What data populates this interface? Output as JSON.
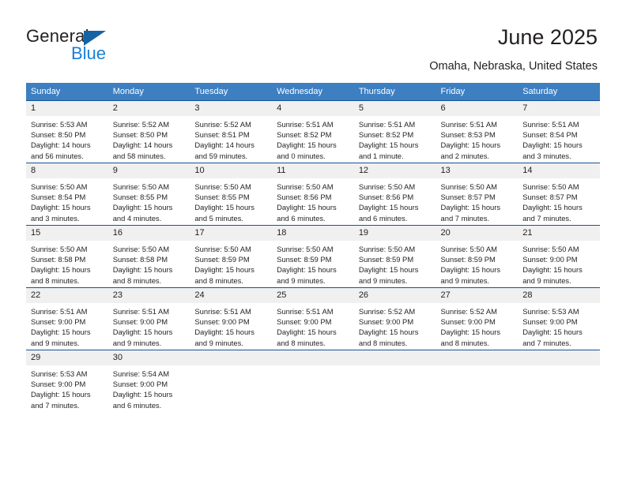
{
  "logo": {
    "word_one": "General",
    "word_two": "Blue",
    "triangle_color": "#1464a5",
    "blue_text_color": "#1b7fd4"
  },
  "header": {
    "title": "June 2025",
    "location": "Omaha, Nebraska, United States"
  },
  "theme": {
    "header_row_bg": "#3d7fc1",
    "cell_top_border": "#15539b",
    "daynum_bg": "#f0f0f0",
    "text_color": "#231f20"
  },
  "columns": [
    "Sunday",
    "Monday",
    "Tuesday",
    "Wednesday",
    "Thursday",
    "Friday",
    "Saturday"
  ],
  "labels": {
    "sunrise_prefix": "Sunrise:",
    "sunset_prefix": "Sunset:",
    "daylight_prefix": "Daylight:"
  },
  "weeks": [
    [
      {
        "day": "1",
        "sunrise": "Sunrise: 5:53 AM",
        "sunset": "Sunset: 8:50 PM",
        "daylight_line1": "Daylight: 14 hours",
        "daylight_line2": "and 56 minutes."
      },
      {
        "day": "2",
        "sunrise": "Sunrise: 5:52 AM",
        "sunset": "Sunset: 8:50 PM",
        "daylight_line1": "Daylight: 14 hours",
        "daylight_line2": "and 58 minutes."
      },
      {
        "day": "3",
        "sunrise": "Sunrise: 5:52 AM",
        "sunset": "Sunset: 8:51 PM",
        "daylight_line1": "Daylight: 14 hours",
        "daylight_line2": "and 59 minutes."
      },
      {
        "day": "4",
        "sunrise": "Sunrise: 5:51 AM",
        "sunset": "Sunset: 8:52 PM",
        "daylight_line1": "Daylight: 15 hours",
        "daylight_line2": "and 0 minutes."
      },
      {
        "day": "5",
        "sunrise": "Sunrise: 5:51 AM",
        "sunset": "Sunset: 8:52 PM",
        "daylight_line1": "Daylight: 15 hours",
        "daylight_line2": "and 1 minute."
      },
      {
        "day": "6",
        "sunrise": "Sunrise: 5:51 AM",
        "sunset": "Sunset: 8:53 PM",
        "daylight_line1": "Daylight: 15 hours",
        "daylight_line2": "and 2 minutes."
      },
      {
        "day": "7",
        "sunrise": "Sunrise: 5:51 AM",
        "sunset": "Sunset: 8:54 PM",
        "daylight_line1": "Daylight: 15 hours",
        "daylight_line2": "and 3 minutes."
      }
    ],
    [
      {
        "day": "8",
        "sunrise": "Sunrise: 5:50 AM",
        "sunset": "Sunset: 8:54 PM",
        "daylight_line1": "Daylight: 15 hours",
        "daylight_line2": "and 3 minutes."
      },
      {
        "day": "9",
        "sunrise": "Sunrise: 5:50 AM",
        "sunset": "Sunset: 8:55 PM",
        "daylight_line1": "Daylight: 15 hours",
        "daylight_line2": "and 4 minutes."
      },
      {
        "day": "10",
        "sunrise": "Sunrise: 5:50 AM",
        "sunset": "Sunset: 8:55 PM",
        "daylight_line1": "Daylight: 15 hours",
        "daylight_line2": "and 5 minutes."
      },
      {
        "day": "11",
        "sunrise": "Sunrise: 5:50 AM",
        "sunset": "Sunset: 8:56 PM",
        "daylight_line1": "Daylight: 15 hours",
        "daylight_line2": "and 6 minutes."
      },
      {
        "day": "12",
        "sunrise": "Sunrise: 5:50 AM",
        "sunset": "Sunset: 8:56 PM",
        "daylight_line1": "Daylight: 15 hours",
        "daylight_line2": "and 6 minutes."
      },
      {
        "day": "13",
        "sunrise": "Sunrise: 5:50 AM",
        "sunset": "Sunset: 8:57 PM",
        "daylight_line1": "Daylight: 15 hours",
        "daylight_line2": "and 7 minutes."
      },
      {
        "day": "14",
        "sunrise": "Sunrise: 5:50 AM",
        "sunset": "Sunset: 8:57 PM",
        "daylight_line1": "Daylight: 15 hours",
        "daylight_line2": "and 7 minutes."
      }
    ],
    [
      {
        "day": "15",
        "sunrise": "Sunrise: 5:50 AM",
        "sunset": "Sunset: 8:58 PM",
        "daylight_line1": "Daylight: 15 hours",
        "daylight_line2": "and 8 minutes."
      },
      {
        "day": "16",
        "sunrise": "Sunrise: 5:50 AM",
        "sunset": "Sunset: 8:58 PM",
        "daylight_line1": "Daylight: 15 hours",
        "daylight_line2": "and 8 minutes."
      },
      {
        "day": "17",
        "sunrise": "Sunrise: 5:50 AM",
        "sunset": "Sunset: 8:59 PM",
        "daylight_line1": "Daylight: 15 hours",
        "daylight_line2": "and 8 minutes."
      },
      {
        "day": "18",
        "sunrise": "Sunrise: 5:50 AM",
        "sunset": "Sunset: 8:59 PM",
        "daylight_line1": "Daylight: 15 hours",
        "daylight_line2": "and 9 minutes."
      },
      {
        "day": "19",
        "sunrise": "Sunrise: 5:50 AM",
        "sunset": "Sunset: 8:59 PM",
        "daylight_line1": "Daylight: 15 hours",
        "daylight_line2": "and 9 minutes."
      },
      {
        "day": "20",
        "sunrise": "Sunrise: 5:50 AM",
        "sunset": "Sunset: 8:59 PM",
        "daylight_line1": "Daylight: 15 hours",
        "daylight_line2": "and 9 minutes."
      },
      {
        "day": "21",
        "sunrise": "Sunrise: 5:50 AM",
        "sunset": "Sunset: 9:00 PM",
        "daylight_line1": "Daylight: 15 hours",
        "daylight_line2": "and 9 minutes."
      }
    ],
    [
      {
        "day": "22",
        "sunrise": "Sunrise: 5:51 AM",
        "sunset": "Sunset: 9:00 PM",
        "daylight_line1": "Daylight: 15 hours",
        "daylight_line2": "and 9 minutes."
      },
      {
        "day": "23",
        "sunrise": "Sunrise: 5:51 AM",
        "sunset": "Sunset: 9:00 PM",
        "daylight_line1": "Daylight: 15 hours",
        "daylight_line2": "and 9 minutes."
      },
      {
        "day": "24",
        "sunrise": "Sunrise: 5:51 AM",
        "sunset": "Sunset: 9:00 PM",
        "daylight_line1": "Daylight: 15 hours",
        "daylight_line2": "and 9 minutes."
      },
      {
        "day": "25",
        "sunrise": "Sunrise: 5:51 AM",
        "sunset": "Sunset: 9:00 PM",
        "daylight_line1": "Daylight: 15 hours",
        "daylight_line2": "and 8 minutes."
      },
      {
        "day": "26",
        "sunrise": "Sunrise: 5:52 AM",
        "sunset": "Sunset: 9:00 PM",
        "daylight_line1": "Daylight: 15 hours",
        "daylight_line2": "and 8 minutes."
      },
      {
        "day": "27",
        "sunrise": "Sunrise: 5:52 AM",
        "sunset": "Sunset: 9:00 PM",
        "daylight_line1": "Daylight: 15 hours",
        "daylight_line2": "and 8 minutes."
      },
      {
        "day": "28",
        "sunrise": "Sunrise: 5:53 AM",
        "sunset": "Sunset: 9:00 PM",
        "daylight_line1": "Daylight: 15 hours",
        "daylight_line2": "and 7 minutes."
      }
    ],
    [
      {
        "day": "29",
        "sunrise": "Sunrise: 5:53 AM",
        "sunset": "Sunset: 9:00 PM",
        "daylight_line1": "Daylight: 15 hours",
        "daylight_line2": "and 7 minutes."
      },
      {
        "day": "30",
        "sunrise": "Sunrise: 5:54 AM",
        "sunset": "Sunset: 9:00 PM",
        "daylight_line1": "Daylight: 15 hours",
        "daylight_line2": "and 6 minutes."
      },
      {
        "day": "",
        "sunrise": "",
        "sunset": "",
        "daylight_line1": "",
        "daylight_line2": ""
      },
      {
        "day": "",
        "sunrise": "",
        "sunset": "",
        "daylight_line1": "",
        "daylight_line2": ""
      },
      {
        "day": "",
        "sunrise": "",
        "sunset": "",
        "daylight_line1": "",
        "daylight_line2": ""
      },
      {
        "day": "",
        "sunrise": "",
        "sunset": "",
        "daylight_line1": "",
        "daylight_line2": ""
      },
      {
        "day": "",
        "sunrise": "",
        "sunset": "",
        "daylight_line1": "",
        "daylight_line2": ""
      }
    ]
  ]
}
